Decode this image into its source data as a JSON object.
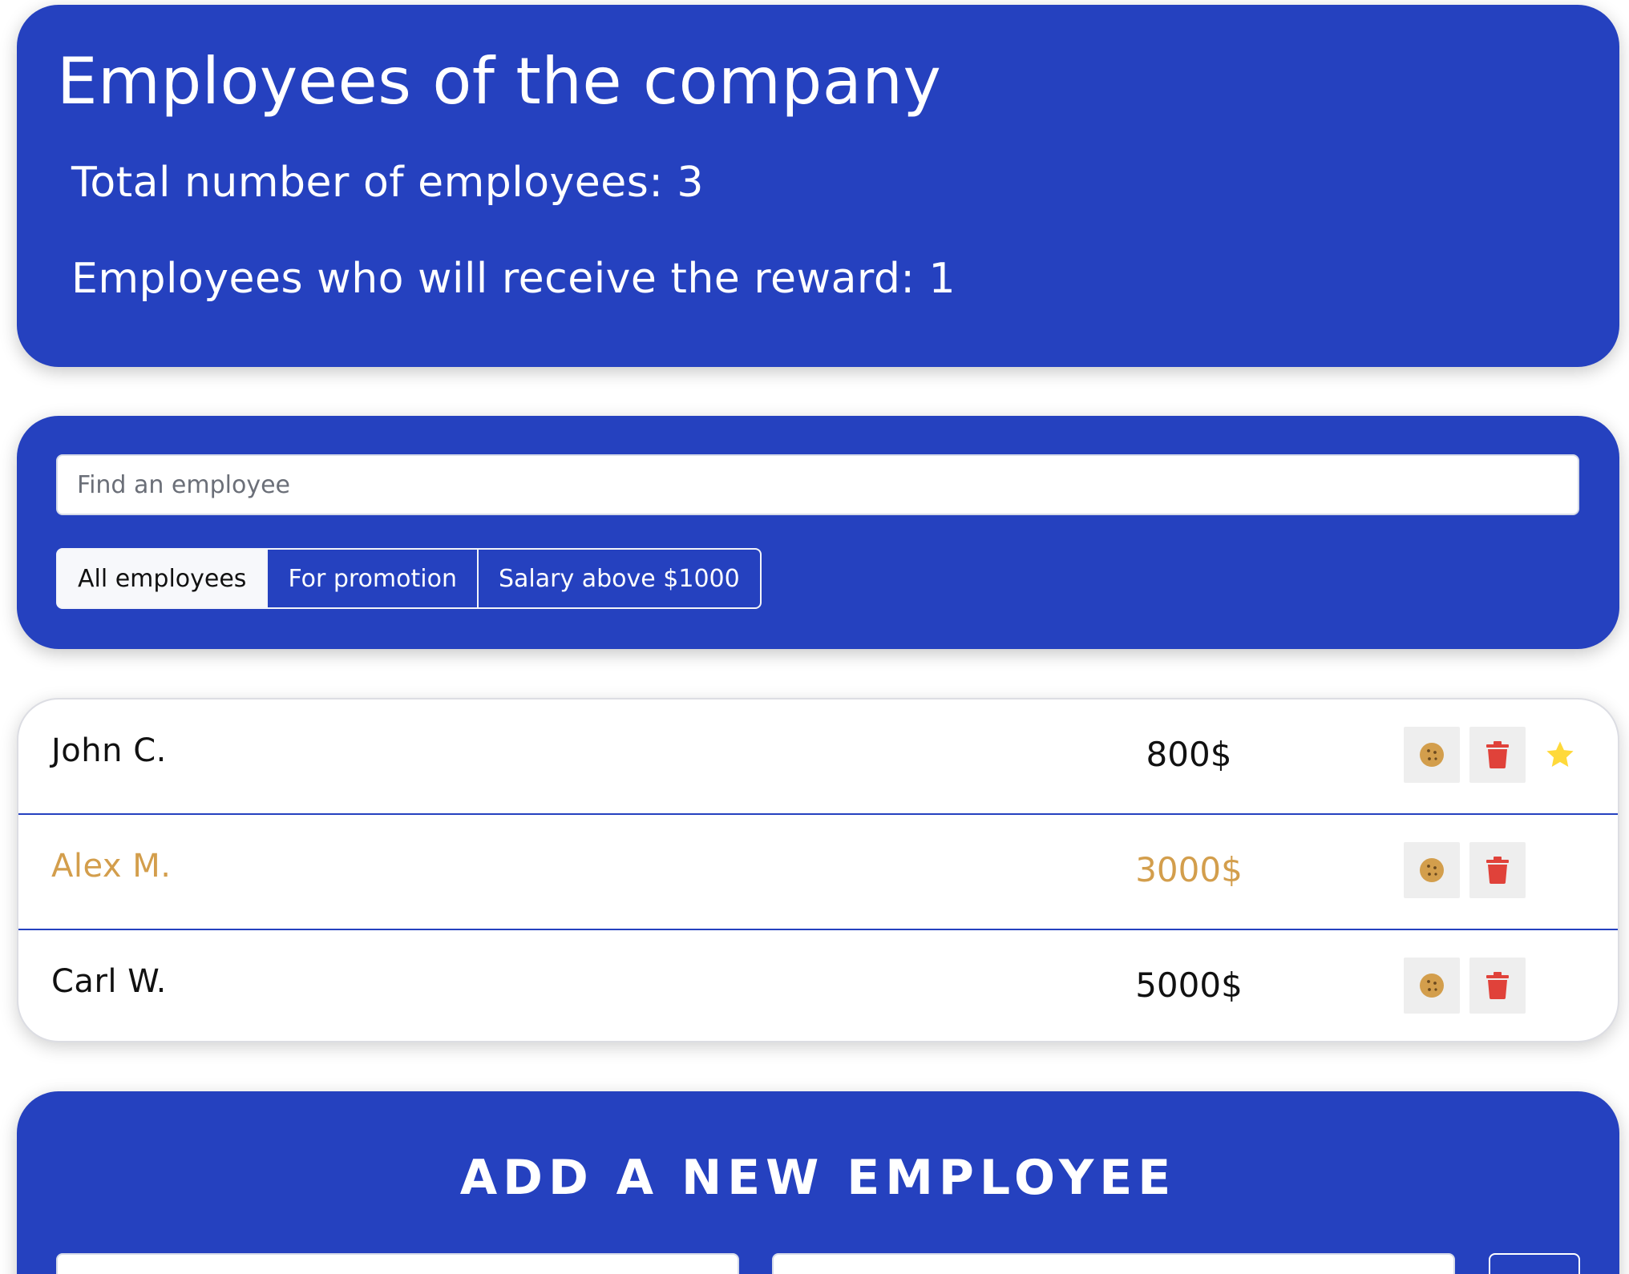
{
  "header": {
    "title": "Employees of the company",
    "total_text": "Total number of employees: 3",
    "reward_text": "Employees who will receive the reward: 1"
  },
  "search": {
    "placeholder": "Find an employee",
    "filters": [
      {
        "label": "All employees",
        "active": true
      },
      {
        "label": "For promotion",
        "active": false
      },
      {
        "label": "Salary above $1000",
        "active": false
      }
    ]
  },
  "employees": [
    {
      "name": "John C.",
      "salary": "800$",
      "increase": false,
      "rise": true
    },
    {
      "name": "Alex M.",
      "salary": "3000$",
      "increase": true,
      "rise": false
    },
    {
      "name": "Carl W.",
      "salary": "5000$",
      "increase": false,
      "rise": false
    }
  ],
  "add_form": {
    "title": "ADD A NEW EMPLOYEE"
  },
  "colors": {
    "panel_bg": "#2541bf",
    "increase_text": "#d39e4c",
    "cookie_icon": "#d39e4c",
    "trash_icon": "#e0423a",
    "star_icon": "#ffd93a",
    "icon_button_bg": "#eeeeee"
  },
  "icons": {
    "cookie_button": "cookie-icon",
    "trash_button": "trash-icon",
    "rise_marker": "star-icon"
  }
}
